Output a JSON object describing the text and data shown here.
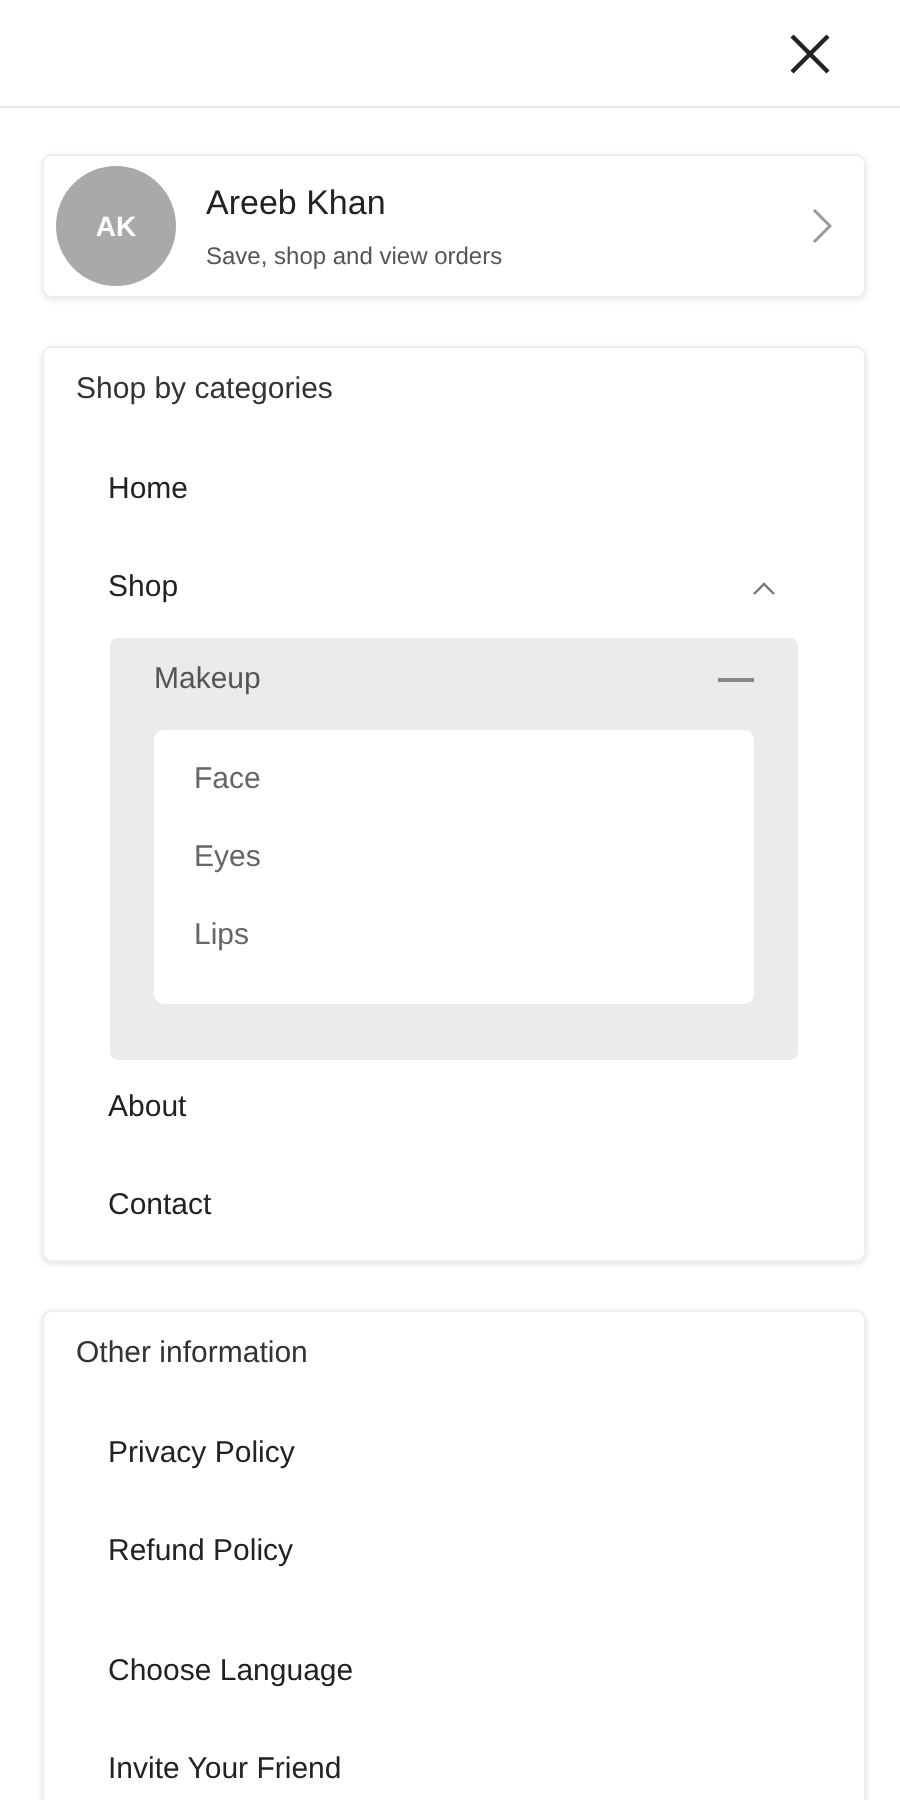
{
  "profile": {
    "initials": "AK",
    "name": "Areeb Khan",
    "subtitle": "Save, shop and view orders"
  },
  "sections": [
    {
      "title": "Shop by categories",
      "items": [
        {
          "label": "Home",
          "kind": "link"
        },
        {
          "label": "Shop",
          "kind": "group",
          "expanded": true,
          "children": [
            {
              "label": "Makeup",
              "expanded": true,
              "children": [
                {
                  "label": "Face"
                },
                {
                  "label": "Eyes"
                },
                {
                  "label": "Lips"
                }
              ]
            }
          ]
        },
        {
          "label": "About",
          "kind": "link"
        },
        {
          "label": "Contact",
          "kind": "link"
        }
      ]
    },
    {
      "title": "Other information",
      "items": [
        {
          "label": "Privacy Policy",
          "kind": "link"
        },
        {
          "label": "Refund Policy",
          "kind": "link"
        },
        {
          "label": "Choose Language",
          "kind": "link",
          "spaced": true
        },
        {
          "label": "Invite Your Friend",
          "kind": "link"
        }
      ]
    }
  ]
}
